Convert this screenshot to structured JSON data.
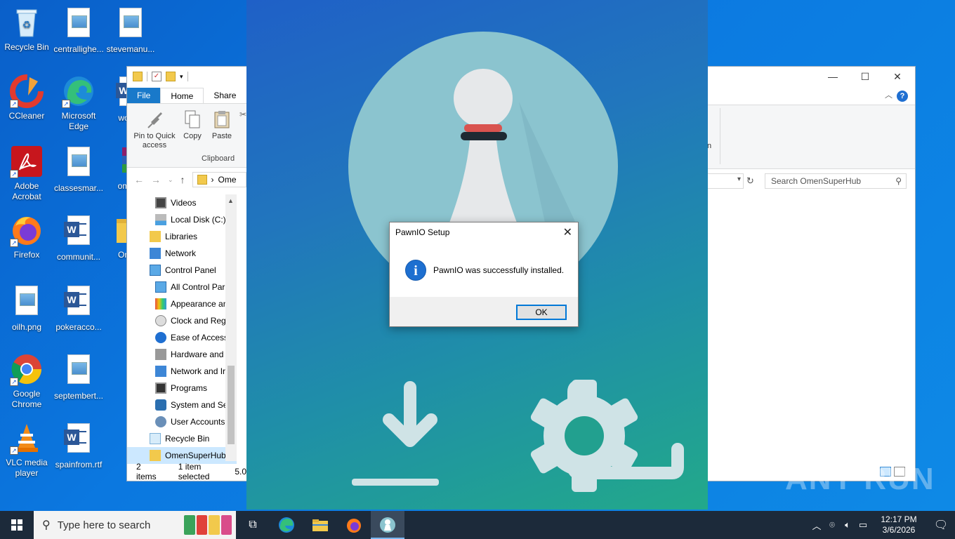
{
  "desktop": {
    "icons": [
      {
        "label": "Recycle Bin"
      },
      {
        "label": "centrallighe..."
      },
      {
        "label": "stevemanu..."
      },
      {
        "label": "CCleaner"
      },
      {
        "label": "Microsoft Edge"
      },
      {
        "label": "work..."
      },
      {
        "label": "Adobe Acrobat"
      },
      {
        "label": "classesmar..."
      },
      {
        "label": "omer..."
      },
      {
        "label": "Firefox"
      },
      {
        "label": "communit..."
      },
      {
        "label": "Ome..."
      },
      {
        "label": "oilh.png"
      },
      {
        "label": "pokeracco..."
      },
      {
        "label": "Google Chrome"
      },
      {
        "label": "septembert..."
      },
      {
        "label": "VLC media player"
      },
      {
        "label": "spainfrom.rtf"
      }
    ]
  },
  "explorer": {
    "tabs": {
      "file": "File",
      "home": "Home",
      "share": "Share"
    },
    "ribbon": {
      "pin": "Pin to Quick access",
      "copy": "Copy",
      "paste": "Paste",
      "group": "Clipboard"
    },
    "address": "Ome",
    "nav": [
      {
        "label": "Videos"
      },
      {
        "label": "Local Disk (C:)"
      },
      {
        "label": "Libraries"
      },
      {
        "label": "Network"
      },
      {
        "label": "Control Panel"
      },
      {
        "label": "All Control Par"
      },
      {
        "label": "Appearance an"
      },
      {
        "label": "Clock and Regi"
      },
      {
        "label": "Ease of Access"
      },
      {
        "label": "Hardware and"
      },
      {
        "label": "Network and Ir"
      },
      {
        "label": "Programs"
      },
      {
        "label": "System and Se"
      },
      {
        "label": "User Accounts"
      },
      {
        "label": "Recycle Bin"
      },
      {
        "label": "OmenSuperHub"
      }
    ],
    "status": {
      "items": "2 items",
      "selected": "1 item selected",
      "size": "5.0"
    },
    "search_placeholder": "Search OmenSuperHub",
    "ribbon_fragment": "n"
  },
  "dialog": {
    "title": "PawnIO Setup",
    "message": "PawnIO was successfully installed.",
    "ok": "OK",
    "icon": "info-icon"
  },
  "taskbar": {
    "search_placeholder": "Type here to search",
    "time": "12:17 PM",
    "date": "3/6/2026"
  },
  "watermark": "ANY RUN"
}
